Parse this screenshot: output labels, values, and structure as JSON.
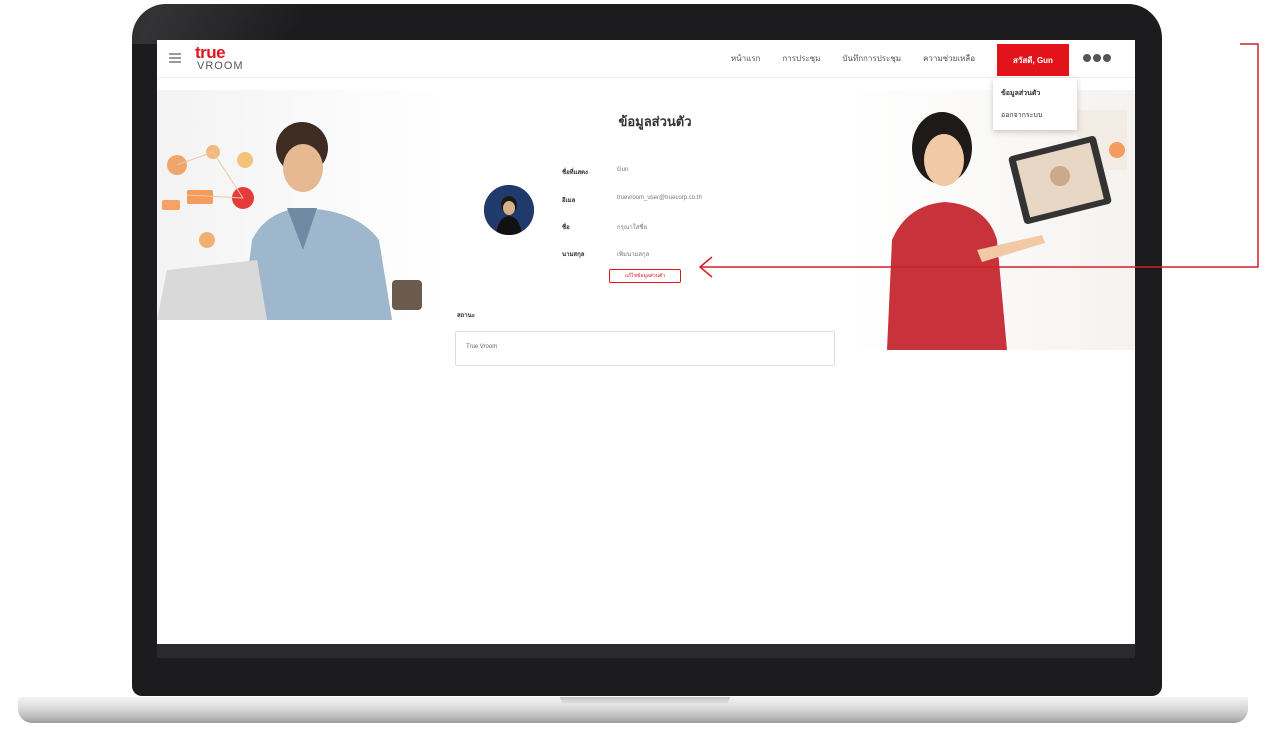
{
  "app": {
    "logo_top": "true",
    "logo_bottom": "VROOM"
  },
  "nav": {
    "links": [
      "หน้าแรก",
      "การประชุม",
      "บันทึกการประชุม",
      "ความช่วยเหลือ"
    ],
    "user_button": "สวัสดี, Gun",
    "dropdown": [
      "ข้อมูลส่วนตัว",
      "ออกจากระบบ"
    ]
  },
  "profile": {
    "title": "ข้อมูลส่วนตัว",
    "rows": [
      {
        "label": "ชื่อที่แสดง",
        "value": "Gun"
      },
      {
        "label": "อีเมล",
        "value": "truevroom_user@truecorp.co.th"
      },
      {
        "label": "ชื่อ",
        "value": "กรุณาใส่ชื่อ"
      },
      {
        "label": "นามสกุล",
        "value": "เพิ่มนามสกุล"
      }
    ],
    "edit_button": "แก้ไขข้อมูลส่วนตัว"
  },
  "section": {
    "label": "สถานะ",
    "value": "True Vroom"
  },
  "colors": {
    "brand_red": "#e3131b",
    "laptop_bezel": "#1c1c1e"
  }
}
